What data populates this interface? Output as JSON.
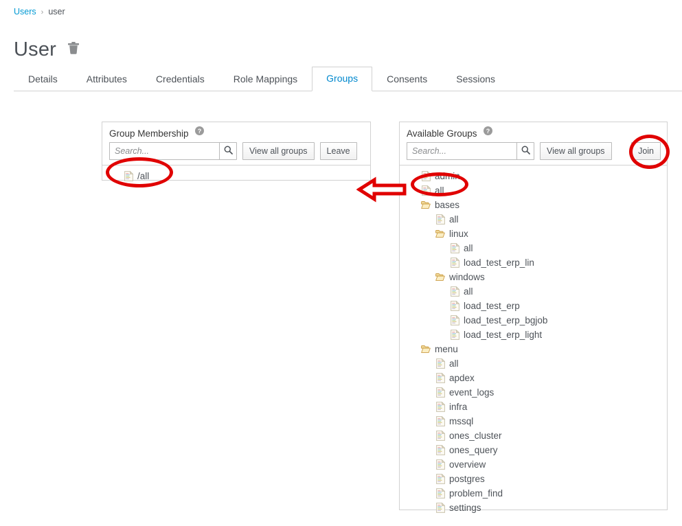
{
  "breadcrumb": {
    "parent": "Users",
    "separator": "›",
    "current": "user"
  },
  "page": {
    "title": "User",
    "delete_icon": "trash-icon"
  },
  "tabs": [
    {
      "label": "Details",
      "active": false
    },
    {
      "label": "Attributes",
      "active": false
    },
    {
      "label": "Credentials",
      "active": false
    },
    {
      "label": "Role Mappings",
      "active": false
    },
    {
      "label": "Groups",
      "active": true
    },
    {
      "label": "Consents",
      "active": false
    },
    {
      "label": "Sessions",
      "active": false
    }
  ],
  "membership_panel": {
    "title": "Group Membership",
    "help_icon": "help-circle-icon",
    "search": {
      "value": "",
      "placeholder": "Search...",
      "icon": "search-icon"
    },
    "view_all_label": "View all groups",
    "leave_label": "Leave",
    "tree": [
      {
        "label": "/all",
        "depth": 0,
        "type": "file"
      }
    ]
  },
  "available_panel": {
    "title": "Available Groups",
    "help_icon": "help-circle-icon",
    "search": {
      "value": "",
      "placeholder": "Search...",
      "icon": "search-icon"
    },
    "view_all_label": "View all groups",
    "join_label": "Join",
    "tree": [
      {
        "label": "admin",
        "depth": 0,
        "type": "file"
      },
      {
        "label": "all",
        "depth": 0,
        "type": "file"
      },
      {
        "label": "bases",
        "depth": 0,
        "type": "folder"
      },
      {
        "label": "all",
        "depth": 1,
        "type": "file"
      },
      {
        "label": "linux",
        "depth": 1,
        "type": "folder"
      },
      {
        "label": "all",
        "depth": 2,
        "type": "file"
      },
      {
        "label": "load_test_erp_lin",
        "depth": 2,
        "type": "file"
      },
      {
        "label": "windows",
        "depth": 1,
        "type": "folder"
      },
      {
        "label": "all",
        "depth": 2,
        "type": "file"
      },
      {
        "label": "load_test_erp",
        "depth": 2,
        "type": "file"
      },
      {
        "label": "load_test_erp_bgjob",
        "depth": 2,
        "type": "file"
      },
      {
        "label": "load_test_erp_light",
        "depth": 2,
        "type": "file"
      },
      {
        "label": "menu",
        "depth": 0,
        "type": "folder"
      },
      {
        "label": "all",
        "depth": 1,
        "type": "file"
      },
      {
        "label": "apdex",
        "depth": 1,
        "type": "file"
      },
      {
        "label": "event_logs",
        "depth": 1,
        "type": "file"
      },
      {
        "label": "infra",
        "depth": 1,
        "type": "file"
      },
      {
        "label": "mssql",
        "depth": 1,
        "type": "file"
      },
      {
        "label": "ones_cluster",
        "depth": 1,
        "type": "file"
      },
      {
        "label": "ones_query",
        "depth": 1,
        "type": "file"
      },
      {
        "label": "overview",
        "depth": 1,
        "type": "file"
      },
      {
        "label": "postgres",
        "depth": 1,
        "type": "file"
      },
      {
        "label": "problem_find",
        "depth": 1,
        "type": "file"
      },
      {
        "label": "settings",
        "depth": 1,
        "type": "file"
      }
    ]
  },
  "annotations": {
    "color": "#e00000",
    "ellipse_membership_all": "highlight-membership-all",
    "ellipse_available_all": "highlight-available-all",
    "ellipse_join_button": "highlight-join-button",
    "arrow": "left-arrow-annotation"
  },
  "colors": {
    "link": "#0099d3",
    "active_tab": "#0088ce",
    "text": "#4d5258",
    "border": "#d1d1d1",
    "annotation_red": "#e00000",
    "folder": "#e8c77d",
    "file": "#f3f0e8"
  }
}
